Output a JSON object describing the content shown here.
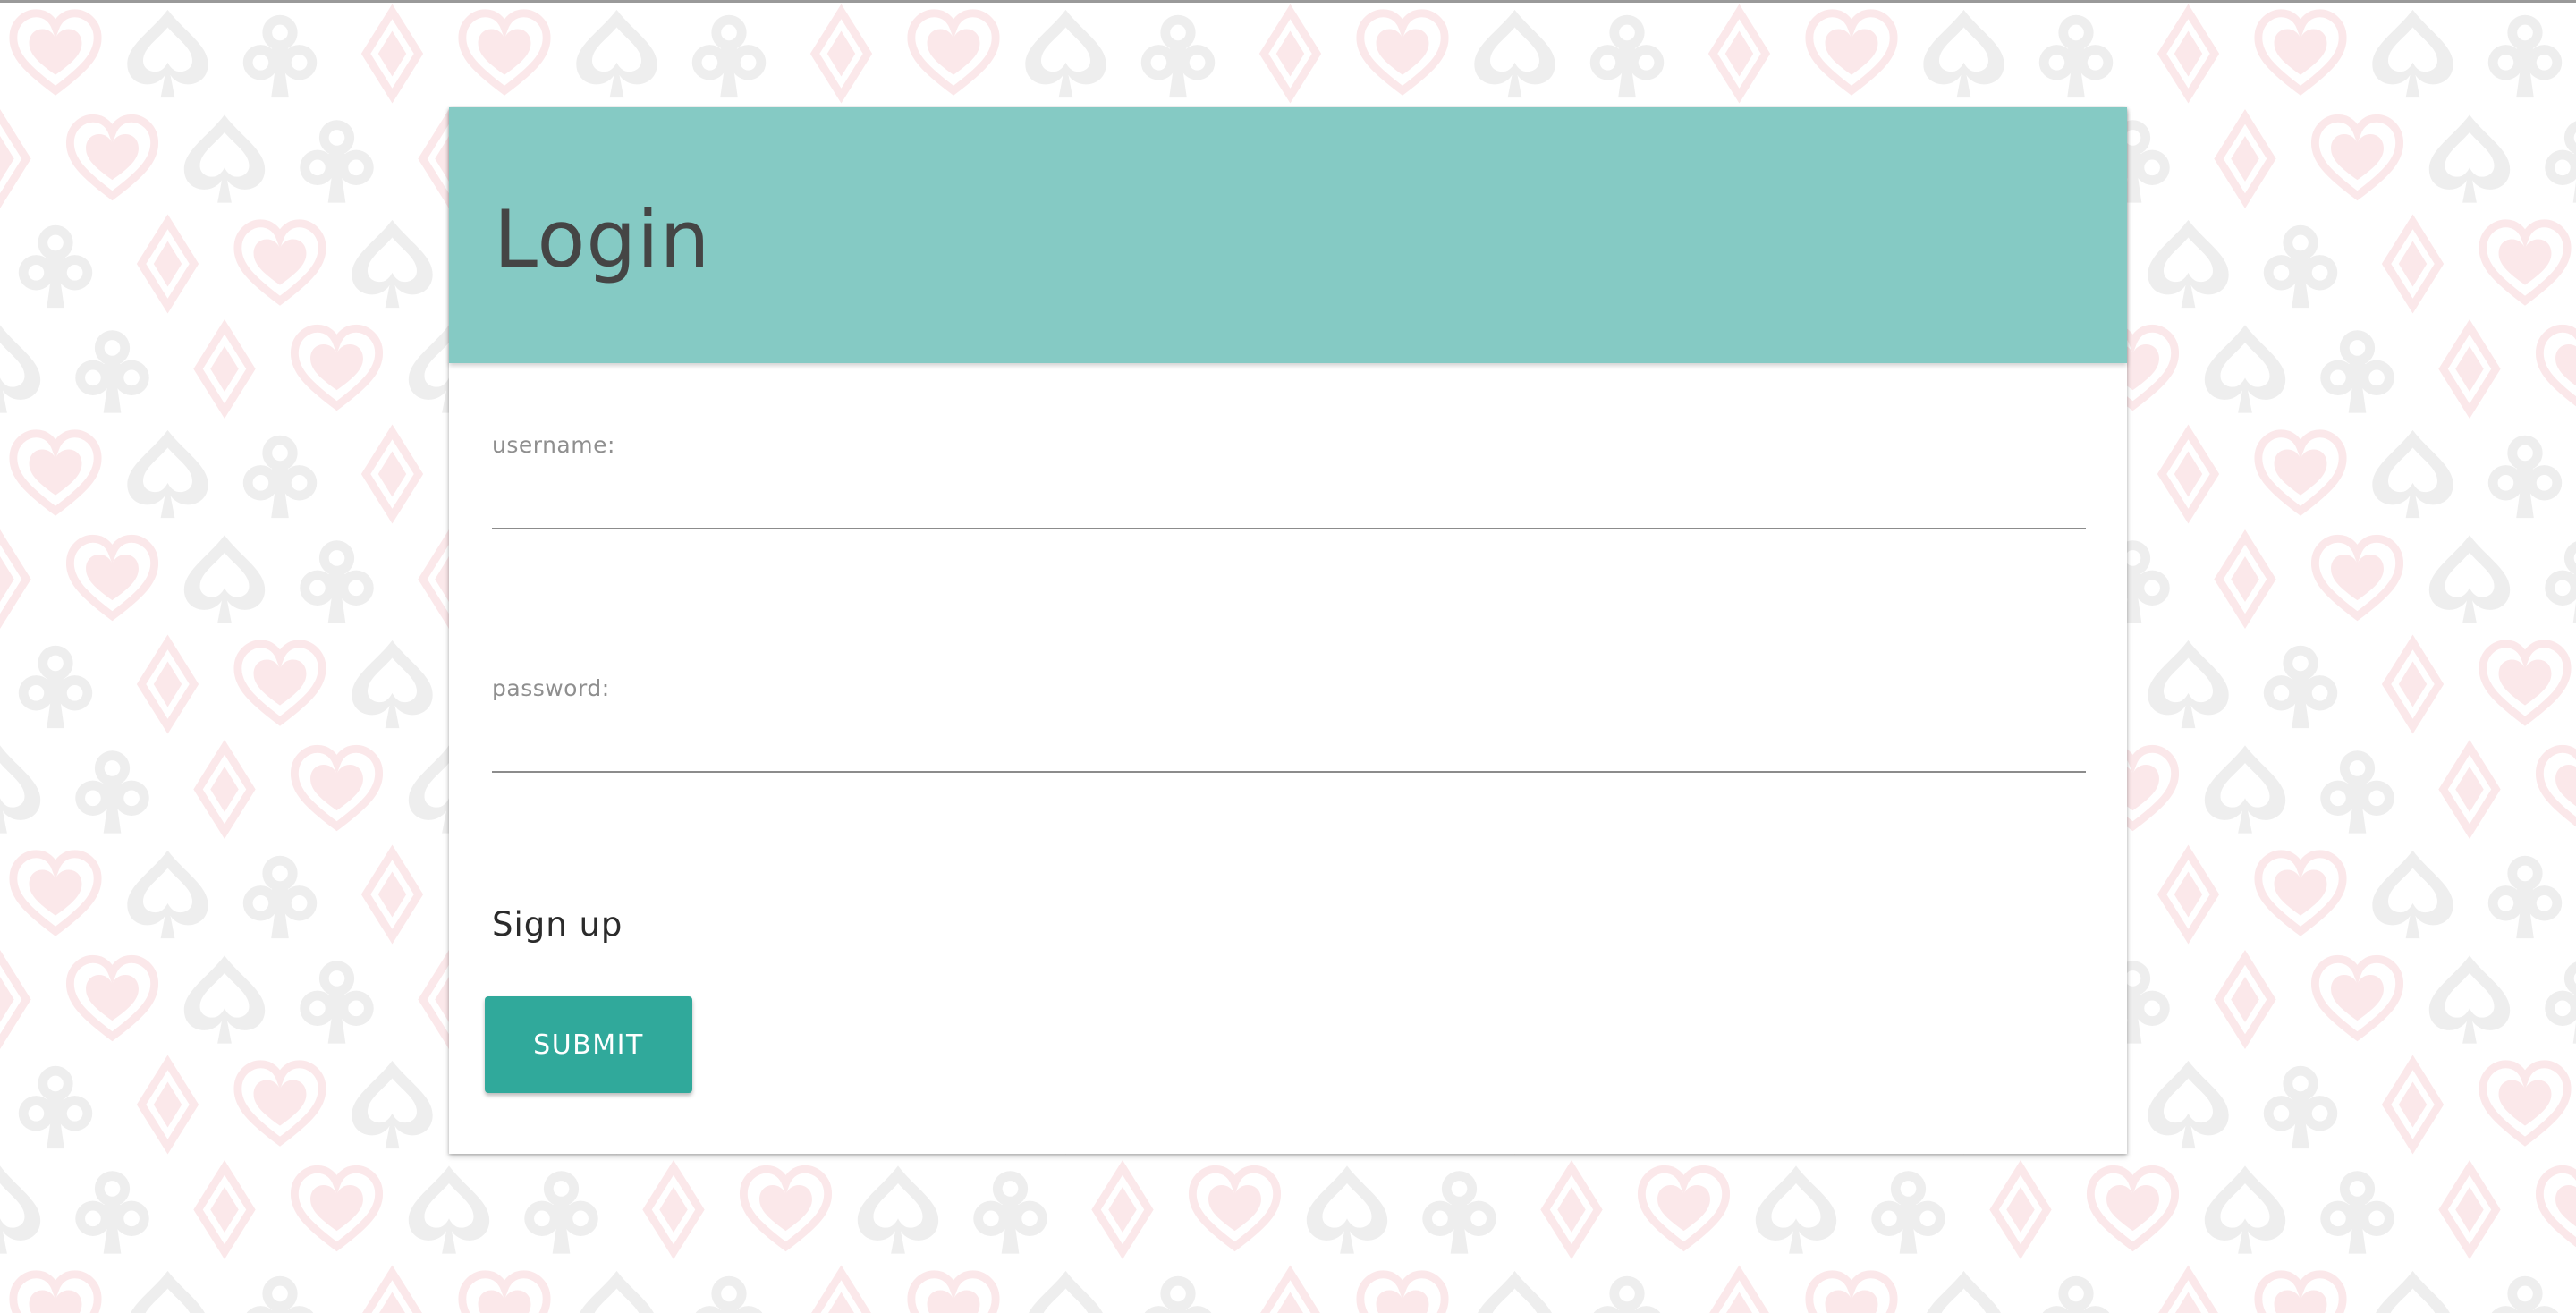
{
  "colors": {
    "header_background": "#85cac4",
    "submit_background": "#30a99b",
    "pattern_pink": "#fbe8ea",
    "pattern_gray": "#eeeeee",
    "title_text": "#454545"
  },
  "pattern": {
    "suits": [
      "heart-icon",
      "spade-icon",
      "club-icon",
      "diamond-icon"
    ]
  },
  "card": {
    "title": "Login"
  },
  "form": {
    "username": {
      "label": "username:",
      "value": "",
      "placeholder": ""
    },
    "password": {
      "label": "password:",
      "value": "",
      "placeholder": ""
    },
    "signup_label": "Sign up",
    "submit_label": "SUBMIT"
  }
}
